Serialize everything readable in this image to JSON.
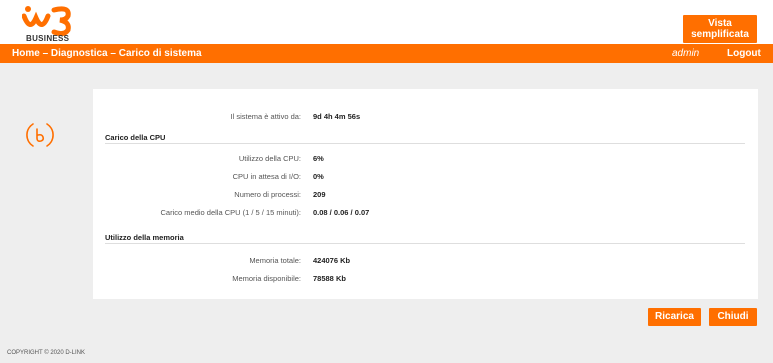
{
  "header": {
    "brand": "BUSINESS",
    "simple_view_line1": "Vista",
    "simple_view_line2": "semplificata"
  },
  "breadcrumb": {
    "home": "Home",
    "sep1": "–",
    "diagnostics": "Diagnostica",
    "sep2": "–",
    "current": "Carico di sistema"
  },
  "user": {
    "name": "admin",
    "logout": "Logout"
  },
  "uptime": {
    "label": "Il sistema è attivo da:",
    "value": "9d 4h 4m 56s"
  },
  "cpu": {
    "section_title": "Carico della CPU",
    "rows": [
      {
        "label": "Utilizzo della CPU:",
        "value": "6%"
      },
      {
        "label": "CPU in attesa di I/O:",
        "value": "0%"
      },
      {
        "label": "Numero di processi:",
        "value": "209"
      },
      {
        "label": "Carico medio della CPU (1 / 5 / 15 minuti):",
        "value": "0.08 / 0.06 / 0.07"
      }
    ]
  },
  "memory": {
    "section_title": "Utilizzo della memoria",
    "rows": [
      {
        "label": "Memoria totale:",
        "value": "424076 Kb"
      },
      {
        "label": "Memoria disponibile:",
        "value": "78588 Kb"
      }
    ]
  },
  "actions": {
    "reload": "Ricarica",
    "close": "Chiudi"
  },
  "footer": "COPYRIGHT © 2020 D-LINK",
  "colors": {
    "accent": "#ff6f00",
    "background": "#eeeeee"
  }
}
